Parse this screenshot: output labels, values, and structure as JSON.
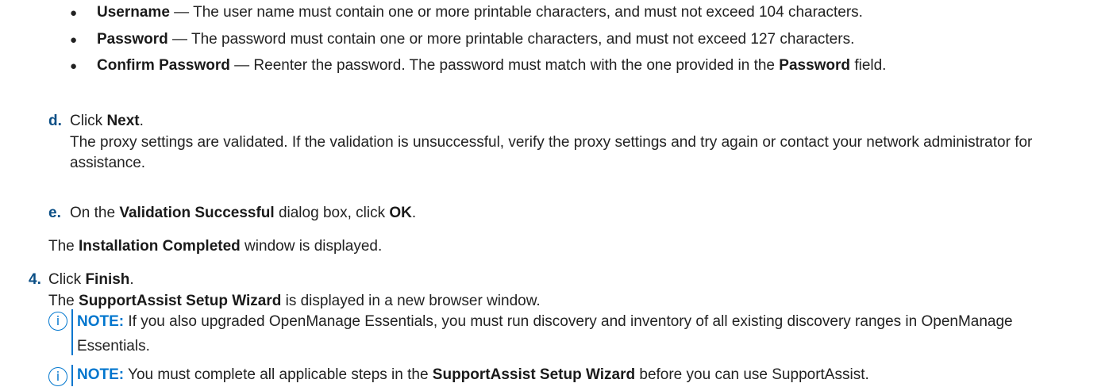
{
  "bullets": [
    {
      "term": "Username",
      "text": " — The user name must contain one or more printable characters, and must not exceed 104 characters."
    },
    {
      "term": "Password",
      "text": " — The password must contain one or more printable characters, and must not exceed 127 characters."
    },
    {
      "term": "Confirm Password",
      "text": " — Reenter the password. The password must match with the one provided in the ",
      "term2": "Password",
      "text2": " field."
    }
  ],
  "step_d": {
    "marker": "d.",
    "pre": "Click ",
    "bold": "Next",
    "post": ".",
    "desc": "The proxy settings are validated. If the validation is unsuccessful, verify the proxy settings and try again or contact your network administrator for assistance."
  },
  "step_e": {
    "marker": "e.",
    "pre": "On the ",
    "bold": "Validation Successful",
    "mid": " dialog box, click ",
    "bold2": "OK",
    "post": "."
  },
  "installation": {
    "pre": "The ",
    "bold": "Installation Completed",
    "post": " window is displayed."
  },
  "step_4": {
    "marker": "4.",
    "pre": "Click ",
    "bold": "Finish",
    "post": ".",
    "desc_pre": "The ",
    "desc_bold": "SupportAssist Setup Wizard",
    "desc_post": " is displayed in a new browser window."
  },
  "note1": {
    "icon": "info-icon",
    "label": "NOTE:",
    "text": " If you also upgraded OpenManage Essentials, you must run discovery and inventory of all existing discovery ranges in OpenManage Essentials."
  },
  "note2": {
    "icon": "info-icon",
    "label": "NOTE:",
    "pre": " You must complete all applicable steps in the ",
    "bold": "SupportAssist Setup Wizard",
    "post": " before you can use SupportAssist."
  },
  "colors": {
    "accent": "#0076ce",
    "marker": "#0b4f86",
    "text": "#222222"
  }
}
